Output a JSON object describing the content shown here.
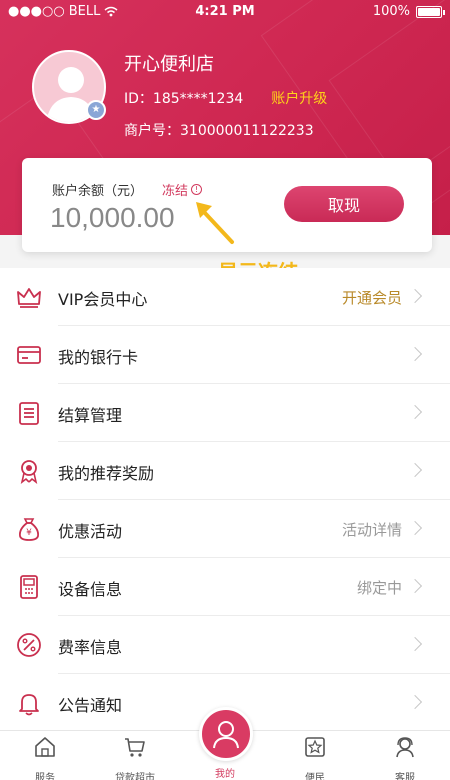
{
  "status_bar": {
    "carrier": "BELL",
    "time": "4:21 PM",
    "battery": "100%"
  },
  "profile": {
    "shop_name": "开心便利店",
    "id_text": "ID：185****1234",
    "upgrade_label": "账户升级",
    "merchant_text": "商户号：310000011122233"
  },
  "balance": {
    "label": "账户余额（元）",
    "frozen_label": "冻结",
    "amount": "10,000.00",
    "withdraw_label": "取现"
  },
  "annotation": {
    "text": "显示冻结"
  },
  "menu": [
    {
      "label": "VIP会员中心",
      "value": "开通会员",
      "icon": "crown-icon"
    },
    {
      "label": "我的银行卡",
      "value": "",
      "icon": "bank-card-icon"
    },
    {
      "label": "结算管理",
      "value": "",
      "icon": "clipboard-icon"
    },
    {
      "label": "我的推荐奖励",
      "value": "",
      "icon": "award-icon"
    },
    {
      "label": "优惠活动",
      "value": "活动详情",
      "icon": "money-bag-icon"
    },
    {
      "label": "设备信息",
      "value": "绑定中",
      "icon": "pos-terminal-icon"
    },
    {
      "label": "费率信息",
      "value": "",
      "icon": "percent-icon"
    },
    {
      "label": "公告通知",
      "value": "",
      "icon": "bell-icon"
    }
  ],
  "tabs": [
    {
      "label": "服务",
      "icon": "home-icon"
    },
    {
      "label": "贷款超市",
      "icon": "cart-icon"
    },
    {
      "label": "我的",
      "icon": "user-icon"
    },
    {
      "label": "便民",
      "icon": "star-icon"
    },
    {
      "label": "客服",
      "icon": "headset-icon"
    }
  ],
  "colors": {
    "brand": "#cf2852",
    "accent_gold": "#ffd21a",
    "annotation": "#f3b81b"
  }
}
